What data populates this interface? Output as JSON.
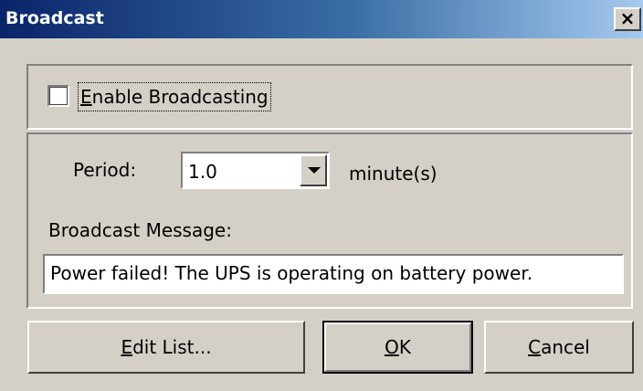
{
  "window": {
    "title": "Broadcast",
    "close_glyph": "×",
    "close_icon": "close-icon"
  },
  "broadcast": {
    "enable_label_mnemonic": "E",
    "enable_label_rest": "nable Broadcasting",
    "enabled": false
  },
  "period": {
    "label": "Period:",
    "value": "1.0",
    "unit_label": "minute(s)",
    "dropdown_icon": "chevron-down-icon"
  },
  "message": {
    "label": "Broadcast Message:",
    "value": "Power failed! The UPS is operating on battery power."
  },
  "buttons": {
    "edit_mnemonic": "E",
    "edit_rest": "dit List...",
    "ok_mnemonic": "O",
    "ok_rest": "K",
    "cancel_mnemonic": "C",
    "cancel_rest": "ancel"
  },
  "colors": {
    "face": "#d4d0c8",
    "title_start": "#0a246a",
    "title_end": "#a6caf0"
  }
}
